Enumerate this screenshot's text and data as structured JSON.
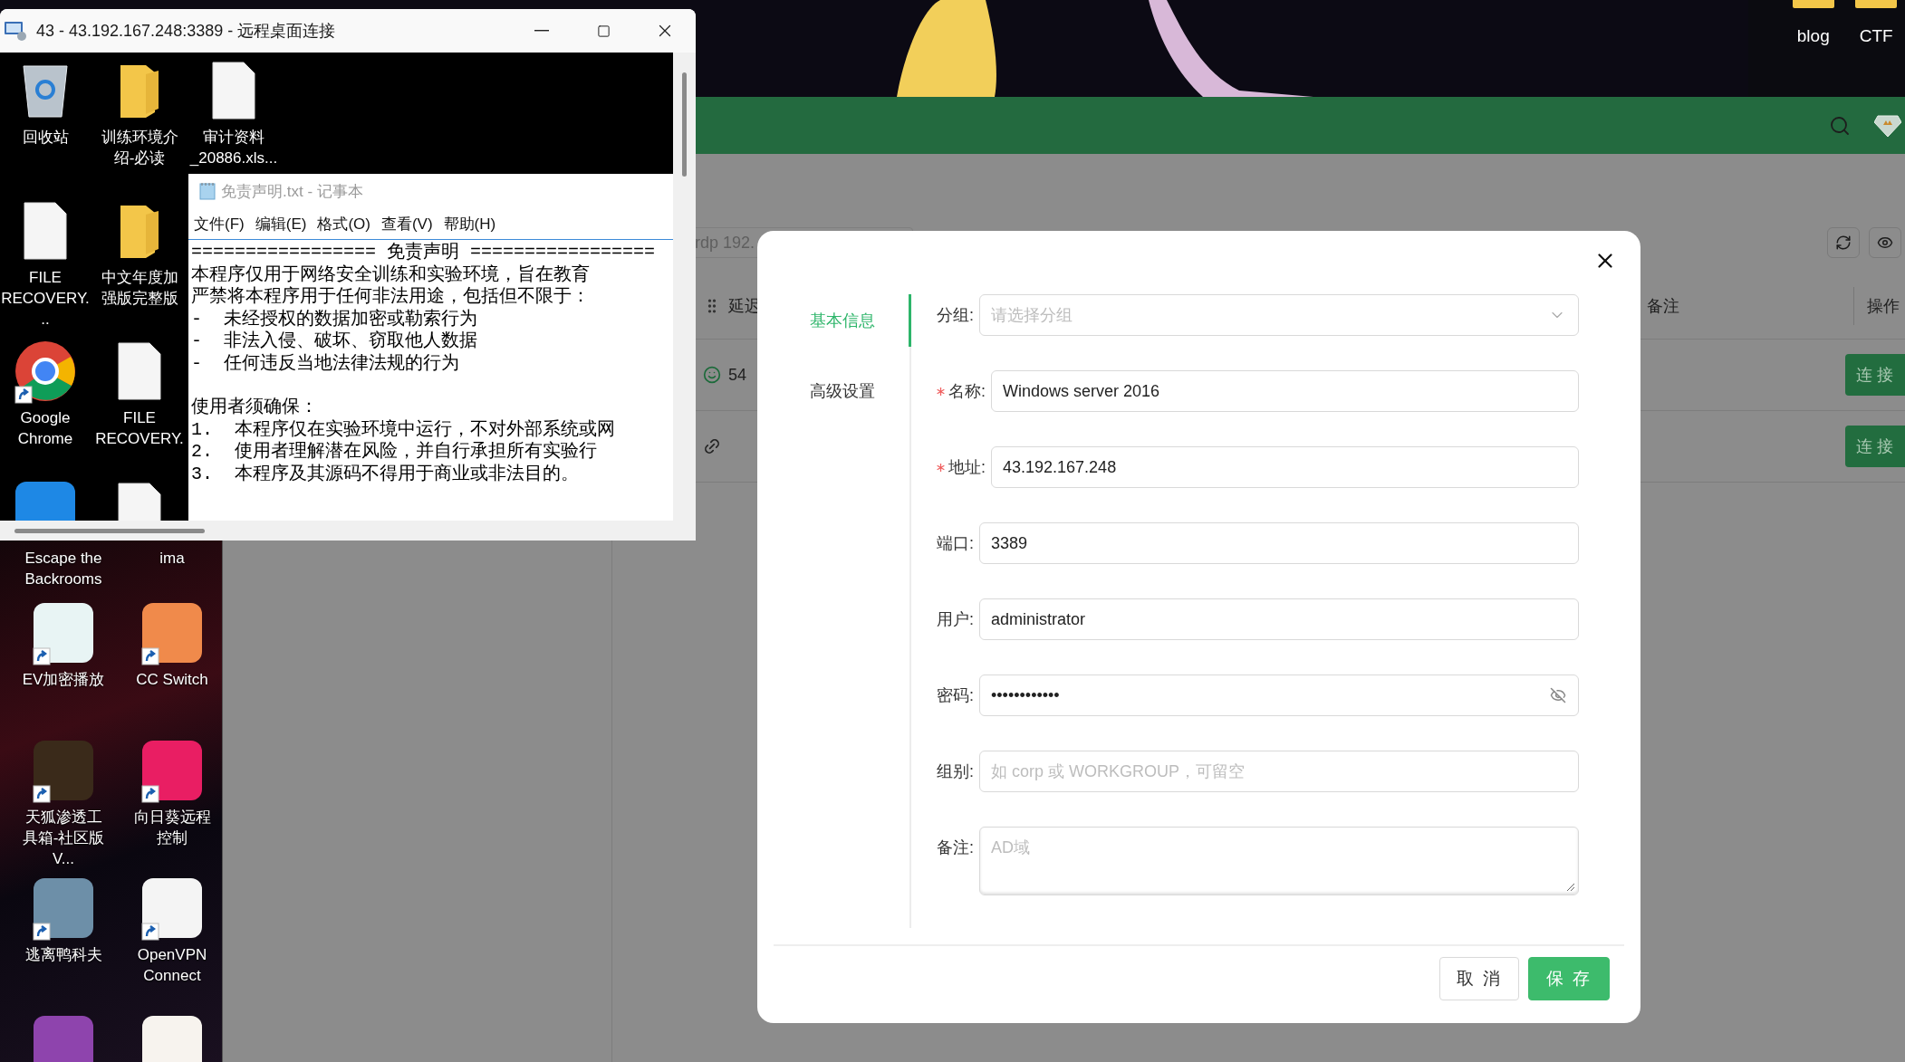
{
  "remote_window": {
    "title": "43 - 43.192.167.248:3389 - 远程桌面连接",
    "icons": [
      {
        "label": "回收站",
        "kind": "bin",
        "shortcut": false
      },
      {
        "label": "FILE RECOVERY...",
        "kind": "file",
        "shortcut": false
      },
      {
        "label": "Google Chrome",
        "kind": "browser",
        "shortcut": true
      },
      {
        "kind": "tile",
        "color": "#1e88e5",
        "shortcut": false
      },
      {
        "label": "训练环境介绍-必读",
        "kind": "folder",
        "shortcut": false
      },
      {
        "label": "中文年度加强版完整版",
        "kind": "folder",
        "shortcut": false
      },
      {
        "label": "FILE RECOVERY.",
        "kind": "file",
        "shortcut": false
      },
      {
        "kind": "file",
        "shortcut": false
      },
      {
        "label": "审计资料_20886.xls...",
        "kind": "file",
        "shortcut": false
      }
    ],
    "notepad": {
      "title": "免责声明.txt - 记事本",
      "menu": [
        "文件(F)",
        "编辑(E)",
        "格式(O)",
        "查看(V)",
        "帮助(H)"
      ],
      "paragraphs": [
        [
          "================= 免责声明 =================",
          "本程序仅用于网络安全训练和实验环境，旨在教育",
          "严禁将本程序用于任何非法用途，包括但不限于：",
          "-  未经授权的数据加密或勒索行为",
          "-  非法入侵、破坏、窃取他人数据",
          "-  任何违反当地法律法规的行为"
        ],
        [
          "使用者须确保：",
          "1.  本程序仅在实验环境中运行，不对外部系统或网",
          "2.  使用者理解潜在风险，并自行承担所有实验行",
          "3.  本程序及其源码不得用于商业或非法目的。"
        ]
      ]
    }
  },
  "host_desktop": {
    "icons": [
      {
        "label": "Escape the Backrooms",
        "kind": "none",
        "shortcut": false
      },
      {
        "label": "ima",
        "kind": "none",
        "shortcut": false
      },
      {
        "label": "EV加密播放",
        "kind": "tile",
        "color": "#e8f4f4",
        "shortcut": true
      },
      {
        "label": "CC Switch",
        "kind": "tile",
        "color": "#f08a4b",
        "shortcut": true
      },
      {
        "label": "天狐渗透工具箱-社区版V...",
        "kind": "tile",
        "color": "#3a2a1a",
        "shortcut": true
      },
      {
        "label": "向日葵远程控制",
        "kind": "tile",
        "color": "#e91e63",
        "shortcut": true
      },
      {
        "label": "逃离鸭科夫",
        "kind": "tile",
        "color": "#6d8fa8",
        "shortcut": true
      },
      {
        "label": "OpenVPN Connect",
        "kind": "tile",
        "color": "#f4f4f4",
        "shortcut": true
      },
      {
        "kind": "tile",
        "color": "#8e44ad",
        "shortcut": false
      },
      {
        "kind": "tile",
        "color": "#f7f3ee",
        "shortcut": false
      }
    ],
    "top_icons": [
      {
        "label": "blog"
      },
      {
        "label": "CTF"
      }
    ]
  },
  "app": {
    "search_placeholder": "rdp 192.",
    "columns": [
      {
        "label": "延迟"
      },
      {
        "label": "备注"
      },
      {
        "label": "操作"
      }
    ],
    "rows": [
      {
        "kind": "ok",
        "latency": "54",
        "action": "连 接"
      },
      {
        "kind": "link",
        "action": "连 接"
      }
    ]
  },
  "dialog": {
    "tabs": [
      {
        "label": "基本信息",
        "selected": true
      },
      {
        "label": "高级设置",
        "selected": false
      }
    ],
    "fields": [
      {
        "label": "分组:",
        "required": false,
        "kind": "select",
        "placeholder": "请选择分组"
      },
      {
        "label": "名称:",
        "required": true,
        "kind": "text",
        "value": "Windows server 2016"
      },
      {
        "label": "地址:",
        "required": true,
        "kind": "text",
        "value": "43.192.167.248"
      },
      {
        "label": "端口:",
        "required": false,
        "kind": "text",
        "value": "3389"
      },
      {
        "label": "用户:",
        "required": false,
        "kind": "text",
        "value": "administrator"
      },
      {
        "label": "密码:",
        "required": false,
        "kind": "password",
        "value": "••••••••••••"
      },
      {
        "label": "组别:",
        "required": false,
        "kind": "text",
        "placeholder": "如 corp 或 WORKGROUP，可留空"
      },
      {
        "label": "备注:",
        "required": false,
        "kind": "textarea",
        "placeholder": "AD域"
      }
    ],
    "buttons": [
      {
        "label": "取 消",
        "kind": "default"
      },
      {
        "label": "保 存",
        "kind": "primary"
      }
    ]
  }
}
